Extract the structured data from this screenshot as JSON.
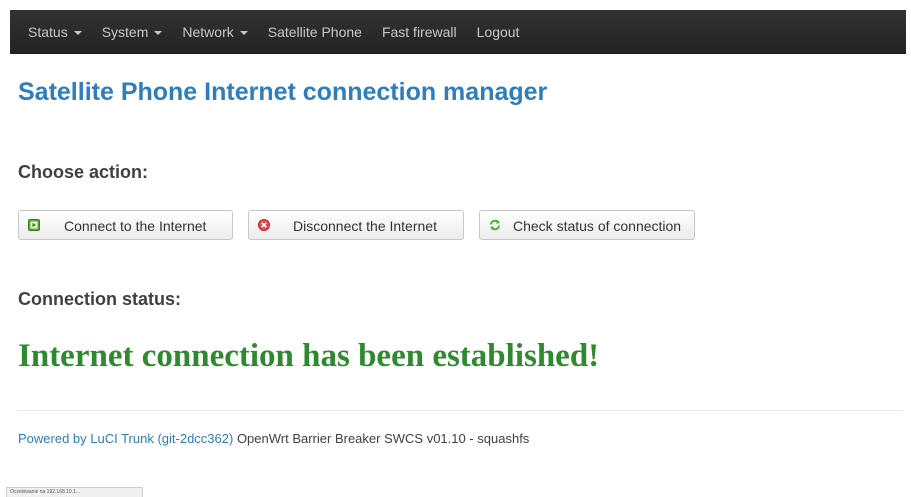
{
  "nav": {
    "items": [
      {
        "label": "Status",
        "dropdown": true
      },
      {
        "label": "System",
        "dropdown": true
      },
      {
        "label": "Network",
        "dropdown": true
      },
      {
        "label": "Satellite Phone",
        "dropdown": false
      },
      {
        "label": "Fast firewall",
        "dropdown": false
      },
      {
        "label": "Logout",
        "dropdown": false
      }
    ]
  },
  "page": {
    "title": "Satellite Phone Internet connection manager",
    "choose_heading": "Choose action:",
    "status_heading": "Connection status:",
    "status_message": "Internet connection has been established!"
  },
  "buttons": {
    "connect": "Connect to the Internet",
    "disconnect": "Disconnect the Internet",
    "check": "Check status of connection"
  },
  "footer": {
    "link": "Powered by LuCI Trunk (git-2dcc362)",
    "text": " OpenWrt Barrier Breaker SWCS v01.10 - squashfs"
  },
  "browser_status": "Oczekiwanie na 192.168.10.1...",
  "colors": {
    "accent": "#2e7dbd",
    "success": "#2f8a2f",
    "navbar": "#2a2a2a"
  }
}
